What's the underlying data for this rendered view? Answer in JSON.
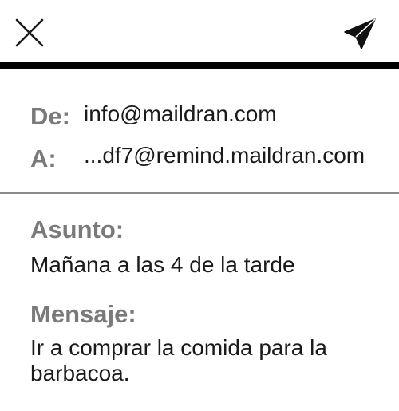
{
  "toolbar": {
    "close_icon": "close-icon",
    "send_icon": "paper-plane-icon"
  },
  "email": {
    "from_label": "De:",
    "from_value": "info@maildran.com",
    "to_label": "A:",
    "to_value": "...df7@remind.maildran.com",
    "subject_label": "Asunto:",
    "subject_value": "Mañana a las 4 de la tarde",
    "message_label": "Mensaje:",
    "message_value": "Ir a comprar la comida para la barbacoa."
  },
  "colors": {
    "label": "#7a7a7a",
    "text": "#1a1a1a",
    "rule": "#000000",
    "divider": "#8a8a8a"
  }
}
